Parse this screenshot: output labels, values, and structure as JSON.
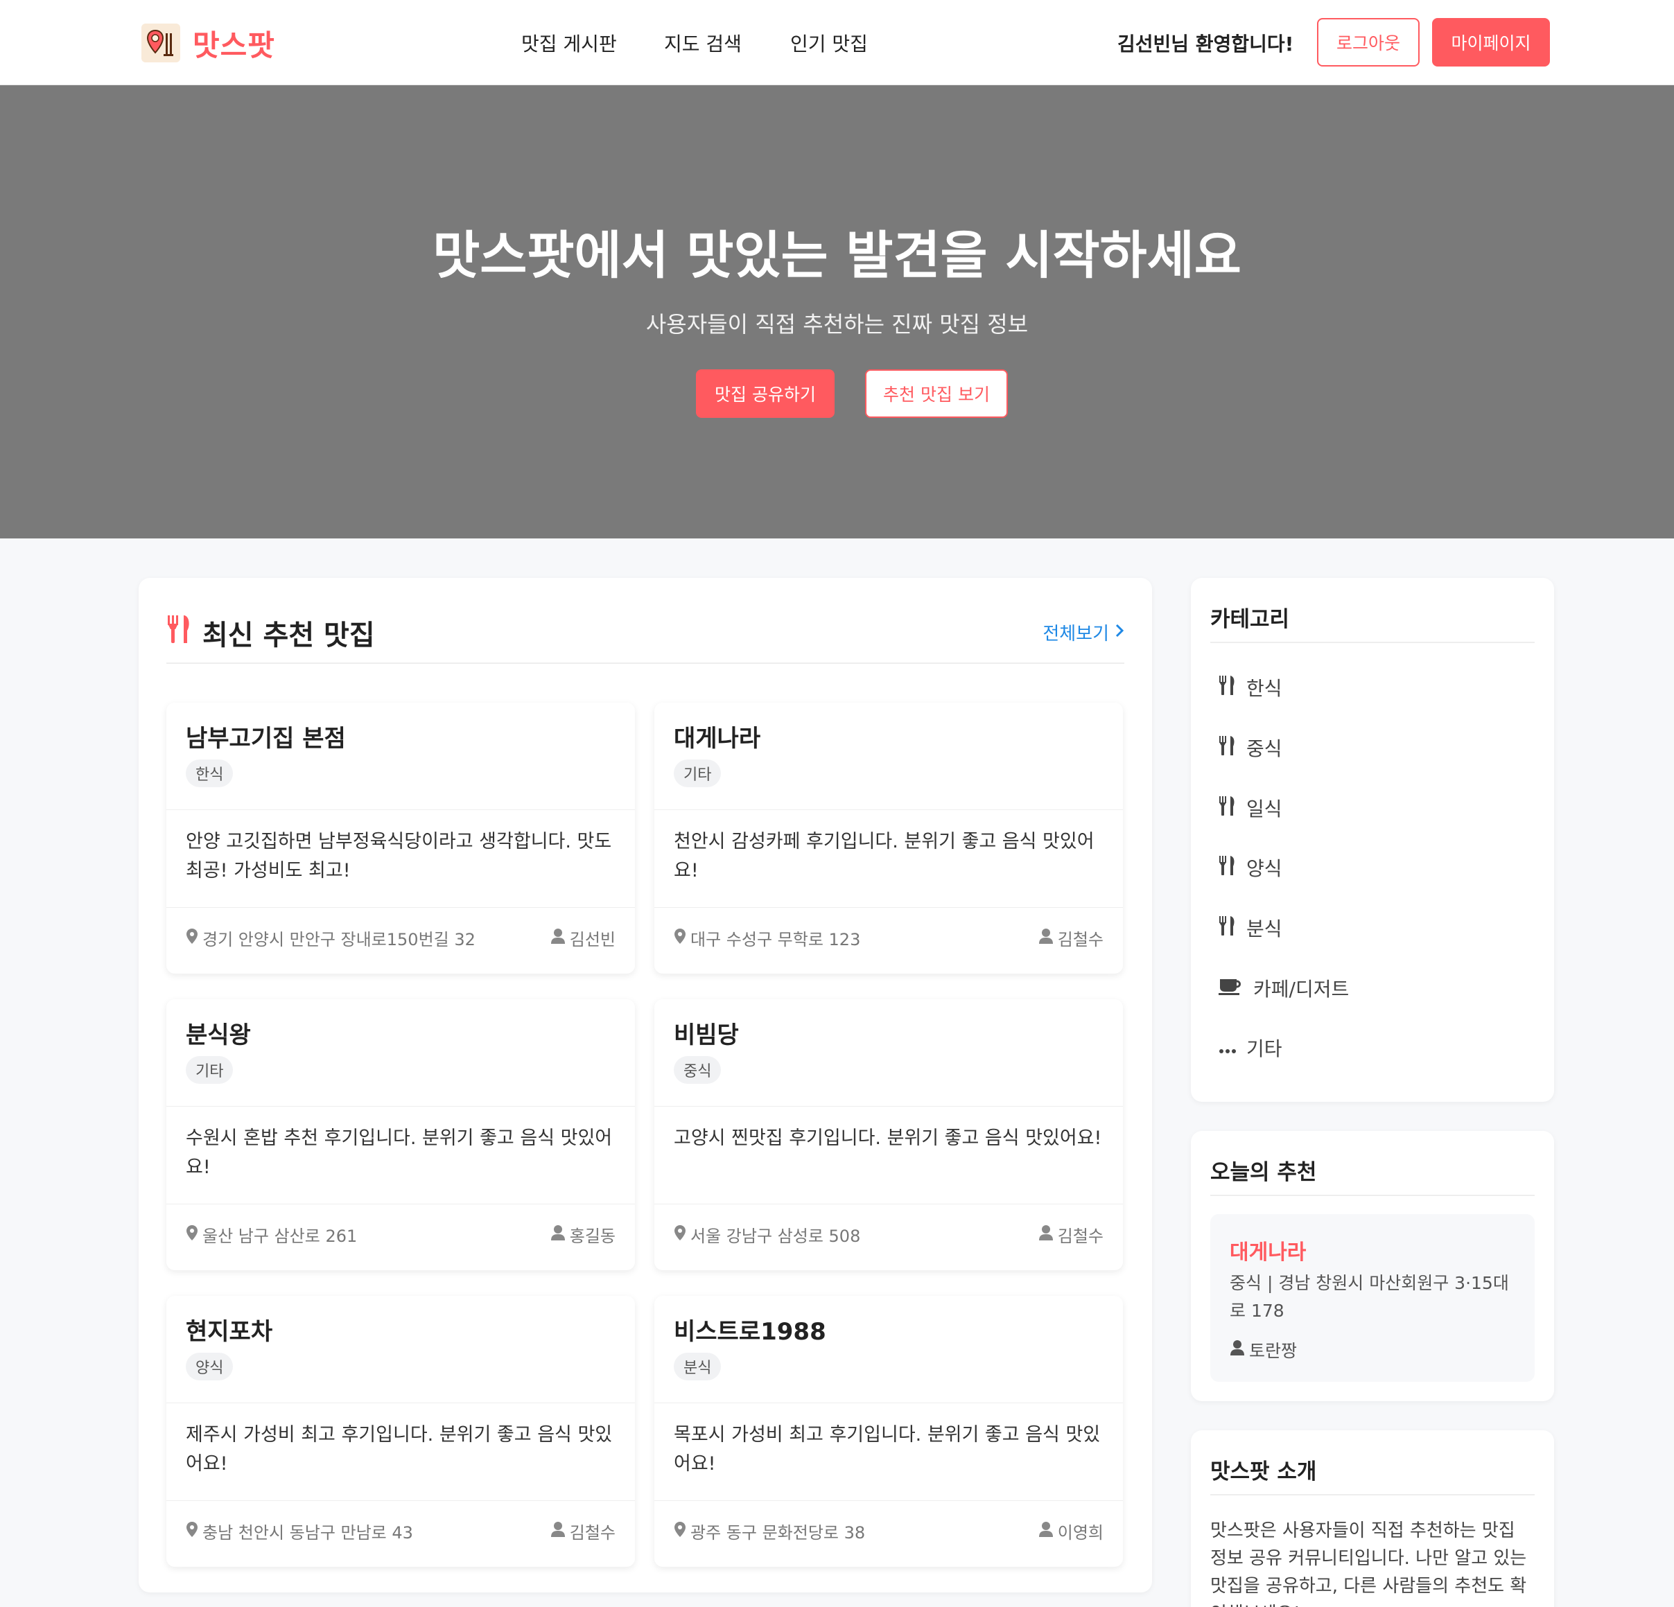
{
  "header": {
    "logo_text": "맛스팟",
    "nav": [
      "맛집 게시판",
      "지도 검색",
      "인기 맛집"
    ],
    "welcome": "김선빈님 환영합니다!",
    "logout_label": "로그아웃",
    "mypage_label": "마이페이지"
  },
  "hero": {
    "title": "맛스팟에서 맛있는 발견을 시작하세요",
    "subtitle": "사용자들이 직접 추천하는 진짜 맛집 정보",
    "share_label": "맛집 공유하기",
    "recommend_label": "추천 맛집 보기"
  },
  "latest": {
    "title": "최신 추천 맛집",
    "view_all": "전체보기",
    "posts": [
      {
        "name": "남부고기집 본점",
        "category": "한식",
        "desc": "안양 고깃집하면 남부정육식당이라고 생각합니다. 맛도 최공! 가성비도 최고!",
        "address": "경기 안양시 만안구 장내로150번길 32",
        "author": "김선빈"
      },
      {
        "name": "대게나라",
        "category": "기타",
        "desc": "천안시 감성카페 후기입니다. 분위기 좋고 음식 맛있어요!",
        "address": "대구 수성구 무학로 123",
        "author": "김철수"
      },
      {
        "name": "분식왕",
        "category": "기타",
        "desc": "수원시 혼밥 추천 후기입니다. 분위기 좋고 음식 맛있어요!",
        "address": "울산 남구 삼산로 261",
        "author": "홍길동"
      },
      {
        "name": "비빔당",
        "category": "중식",
        "desc": "고양시 찐맛집 후기입니다. 분위기 좋고 음식 맛있어요!",
        "address": "서울 강남구 삼성로 508",
        "author": "김철수"
      },
      {
        "name": "현지포차",
        "category": "양식",
        "desc": "제주시 가성비 최고 후기입니다. 분위기 좋고 음식 맛있어요!",
        "address": "충남 천안시 동남구 만남로 43",
        "author": "김철수"
      },
      {
        "name": "비스트로1988",
        "category": "분식",
        "desc": "목포시 가성비 최고 후기입니다. 분위기 좋고 음식 맛있어요!",
        "address": "광주 동구 문화전당로 38",
        "author": "이영희"
      }
    ]
  },
  "categories": {
    "title": "카테고리",
    "items": [
      {
        "label": "한식",
        "icon": "utensils-icon"
      },
      {
        "label": "중식",
        "icon": "utensils-icon"
      },
      {
        "label": "일식",
        "icon": "utensils-icon"
      },
      {
        "label": "양식",
        "icon": "utensils-icon"
      },
      {
        "label": "분식",
        "icon": "utensils-icon"
      },
      {
        "label": "카페/디저트",
        "icon": "coffee-icon"
      },
      {
        "label": "기타",
        "icon": "ellipsis-icon"
      }
    ]
  },
  "today": {
    "title": "오늘의 추천",
    "name": "대게나라",
    "info": "중식 | 경남 창원시 마산회원구 3·15대로 178",
    "author": "토란짱"
  },
  "about": {
    "title": "맛스팟 소개",
    "text": "맛스팟은 사용자들이 직접 추천하는 맛집 정보 공유 커뮤니티입니다. 나만 알고 있는 맛집을 공유하고, 다른 사람들의 추천도 확인해보세요!"
  },
  "colors": {
    "accent": "#ff5a5f",
    "link": "#1e88e5",
    "hero_bg": "#7a7a7a"
  }
}
